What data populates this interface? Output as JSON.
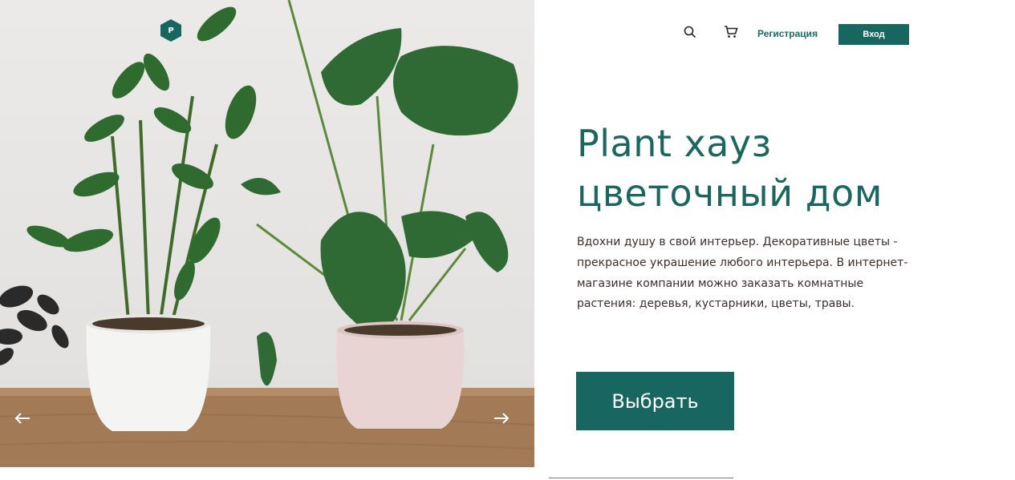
{
  "brand": {
    "logo_letter": "P",
    "accent_color": "#17665f"
  },
  "header": {
    "search_icon": "search-icon",
    "cart_icon": "cart-icon",
    "register_label": "Регистрация",
    "login_label": "Вход"
  },
  "hero": {
    "image": "potted-plants-photo",
    "title_line1": "Plant хауз",
    "title_line2": "цветочный дом",
    "description": "Вдохни душу в свой интерьер. Декоративные цветы - прекрасное украшение любого интерьера. В интернет-магазине компании можно заказать комнатные растения: деревья, кустарники, цветы, травы.",
    "cta_label": "Выбрать"
  },
  "slider": {
    "prev_icon": "arrow-left-icon",
    "next_icon": "arrow-right-icon"
  }
}
